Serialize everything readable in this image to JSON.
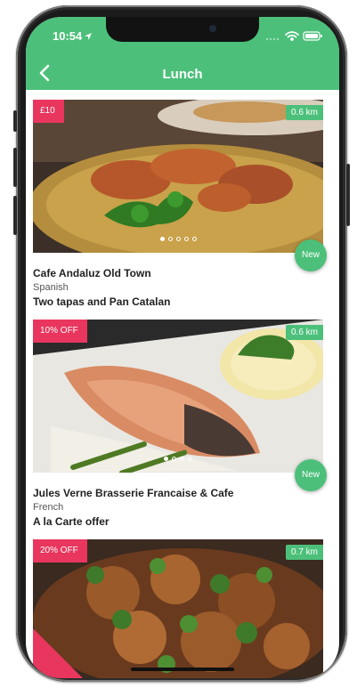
{
  "status_bar": {
    "time": "10:54"
  },
  "header": {
    "title": "Lunch"
  },
  "colors": {
    "accent": "#4cc07a",
    "tag": "#e8365e"
  },
  "restaurants": [
    {
      "tag": "£10",
      "distance": "0.6 km",
      "name": "Cafe Andaluz Old Town",
      "cuisine": "Spanish",
      "offer": "Two tapas and Pan Catalan",
      "badge": "New",
      "photo_index": 0,
      "photo_count": 5
    },
    {
      "tag": "10% OFF",
      "distance": "0.6 km",
      "name": "Jules Verne Brasserie Francaise & Cafe",
      "cuisine": "French",
      "offer": "A la Carte offer",
      "badge": "New",
      "photo_index": 0,
      "photo_count": 4
    },
    {
      "tag": "20% OFF",
      "distance": "0.7 km"
    }
  ]
}
